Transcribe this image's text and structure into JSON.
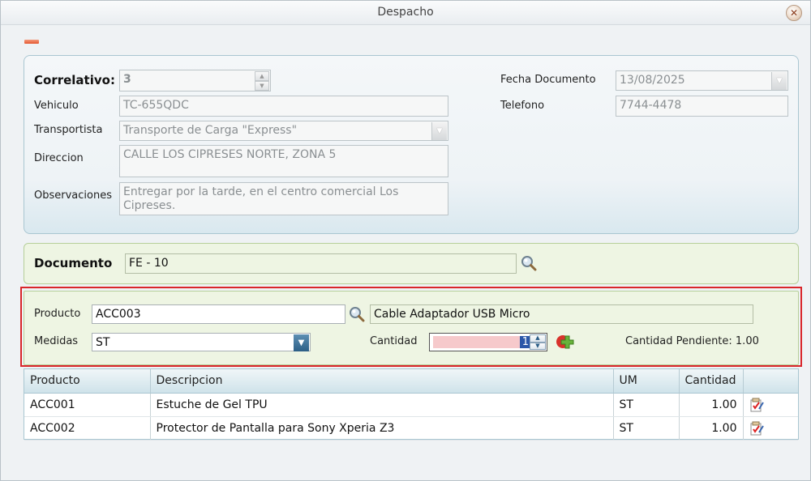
{
  "window": {
    "title": "Despacho"
  },
  "header": {
    "correlativo_label": "Correlativo:",
    "correlativo_value": "3",
    "vehiculo_label": "Vehiculo",
    "vehiculo_value": "TC-655QDC",
    "transportista_label": "Transportista",
    "transportista_value": "Transporte de Carga \"Express\"",
    "direccion_label": "Direccion",
    "direccion_value": "CALLE LOS CIPRESES NORTE, ZONA 5",
    "observaciones_label": "Observaciones",
    "observaciones_value": "Entregar por la tarde, en el centro comercial Los Cipreses.",
    "fecha_label": "Fecha Documento",
    "fecha_value": "13/08/2025",
    "telefono_label": "Telefono",
    "telefono_value": "7744-4478"
  },
  "documento": {
    "label": "Documento",
    "value": "FE - 10"
  },
  "producto": {
    "producto_label": "Producto",
    "producto_value": "ACC003",
    "descripcion_value": "Cable Adaptador USB Micro",
    "medidas_label": "Medidas",
    "medidas_value": "ST",
    "cantidad_label": "Cantidad",
    "cantidad_value": "1",
    "pendiente_text": "Cantidad Pendiente: 1.00"
  },
  "grid": {
    "columns": [
      "Producto",
      "Descripcion",
      "UM",
      "Cantidad",
      ""
    ],
    "rows": [
      {
        "producto": "ACC001",
        "descripcion": "Estuche de Gel TPU",
        "um": "ST",
        "cantidad": "1.00",
        "icon": "edit-icon"
      },
      {
        "producto": "ACC002",
        "descripcion": "Protector de Pantalla para Sony Xperia Z3",
        "um": "ST",
        "cantidad": "1.00",
        "icon": "edit-icon"
      }
    ]
  },
  "colors": {
    "highlight": "#d9262b",
    "green_panel": "#eef5e3",
    "blue_panel_border": "#a9c6d1",
    "qty_fill": "#f6c9cb"
  }
}
